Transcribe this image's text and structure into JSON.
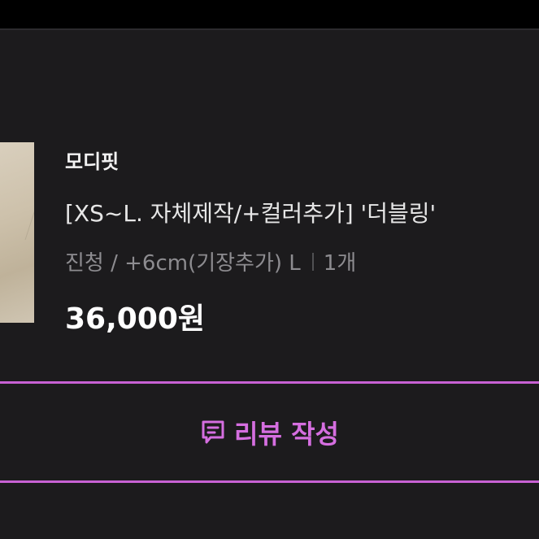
{
  "order_item": {
    "brand": "모디핏",
    "title": "[XS~L. 자체제작/+컬러추가] '더블링'",
    "option": "진청 / +6cm(기장추가) L",
    "quantity": "1개",
    "price": "36,000원"
  },
  "review_button": {
    "label": "리뷰 작성",
    "icon": "chat-bubble-icon"
  },
  "colors": {
    "background": "#1c1b1d",
    "accent": "#d56ee0",
    "accent_border": "#c861d4",
    "text_primary": "#ffffff",
    "text_secondary": "#8d8c90"
  }
}
